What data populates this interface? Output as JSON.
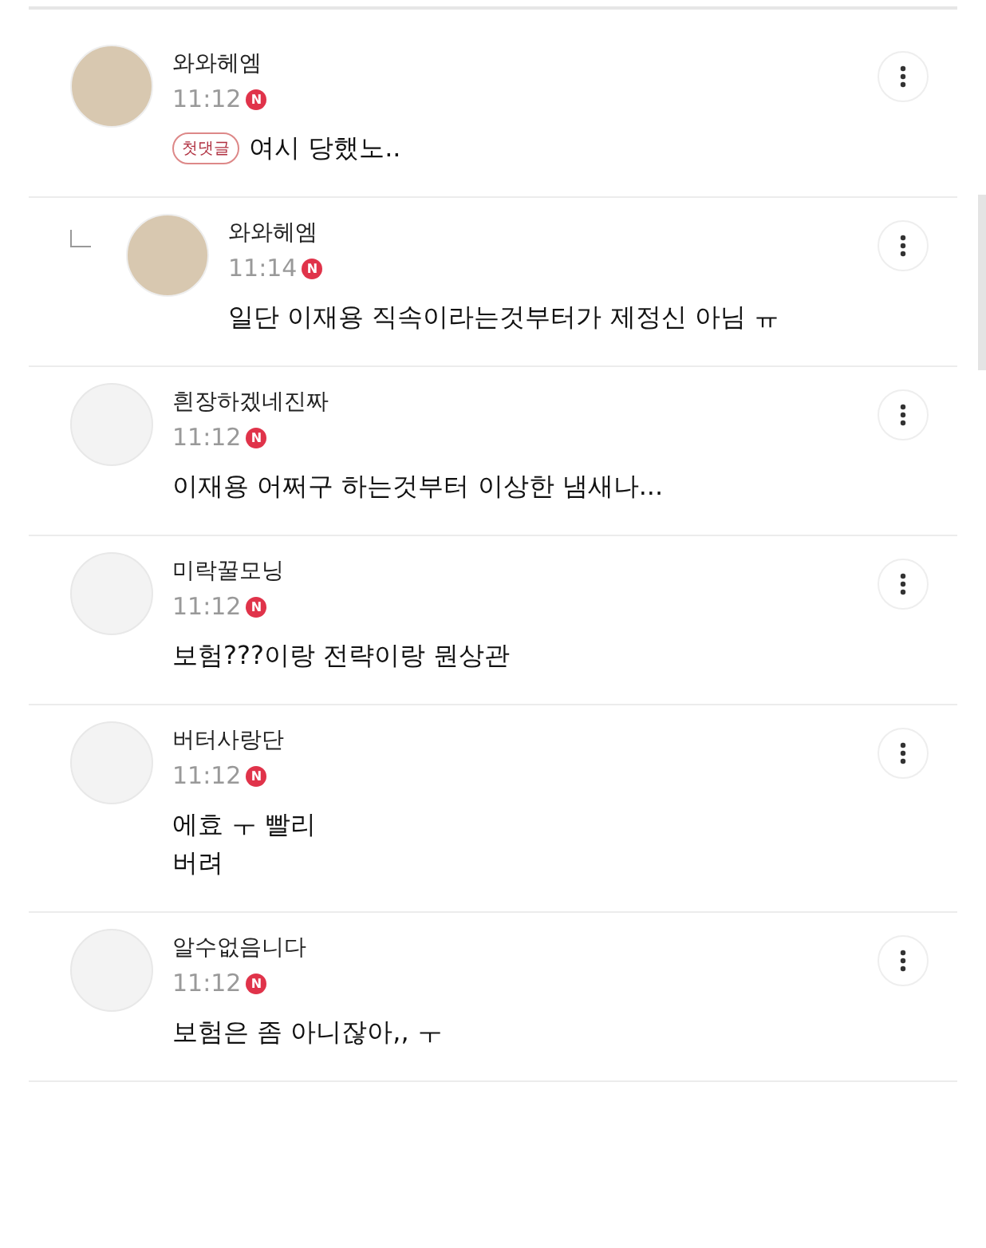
{
  "comments": [
    {
      "author": "와와헤엠",
      "time": "11:12",
      "new_mark": "N",
      "badge": "첫댓글",
      "text": "여시 당했노..",
      "reply": false,
      "photo_avatar": true
    },
    {
      "author": "와와헤엠",
      "time": "11:14",
      "new_mark": "N",
      "text": "일단 이재용 직속이라는것부터가 제정신 아님 ㅠ",
      "reply": true,
      "photo_avatar": true
    },
    {
      "author": "흰장하겠네진짜",
      "time": "11:12",
      "new_mark": "N",
      "text": "이재용 어쩌구 하는것부터 이상한 냄새나...",
      "reply": false,
      "photo_avatar": false
    },
    {
      "author": "미락꿀모닝",
      "time": "11:12",
      "new_mark": "N",
      "text": "보험???이랑 전략이랑 뭔상관",
      "reply": false,
      "photo_avatar": false
    },
    {
      "author": "버터사랑단",
      "time": "11:12",
      "new_mark": "N",
      "text": "에효 ㅜ 빨리\n버려",
      "reply": false,
      "photo_avatar": false
    },
    {
      "author": "알수없음니다",
      "time": "11:12",
      "new_mark": "N",
      "text": "보험은 좀 아니잖아,, ㅜ",
      "reply": false,
      "photo_avatar": false
    }
  ]
}
